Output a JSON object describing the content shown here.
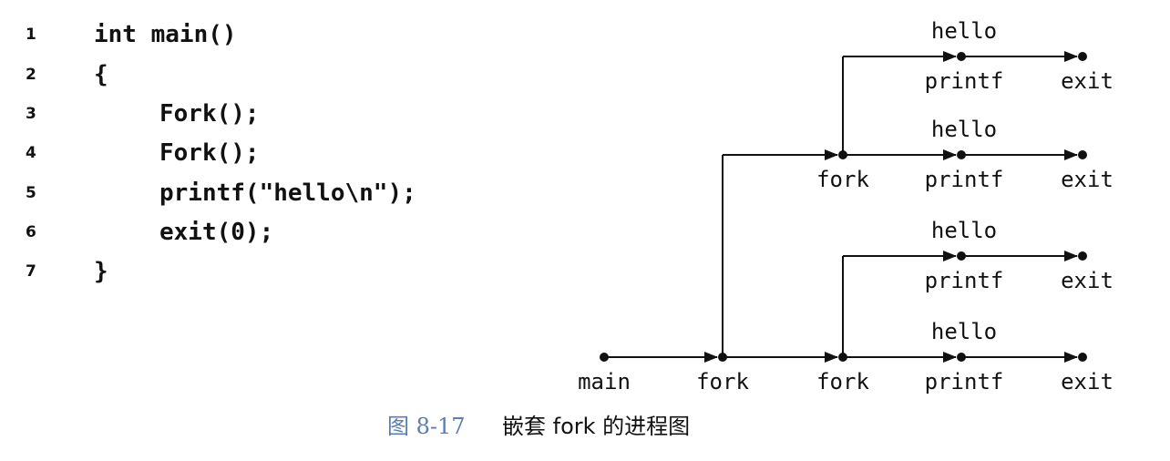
{
  "code": {
    "lines": [
      {
        "no": "1",
        "text": "int main()",
        "indent": 0
      },
      {
        "no": "2",
        "text": "{",
        "indent": 0
      },
      {
        "no": "3",
        "text": "Fork();",
        "indent": 1
      },
      {
        "no": "4",
        "text": "Fork();",
        "indent": 1
      },
      {
        "no": "5",
        "text": "printf(\"hello\\n\");",
        "indent": 1
      },
      {
        "no": "6",
        "text": "exit(0);",
        "indent": 1
      },
      {
        "no": "7",
        "text": "}",
        "indent": 0
      }
    ]
  },
  "diagram": {
    "labels": {
      "main": "main",
      "fork": "fork",
      "printf": "printf",
      "exit": "exit",
      "hello": "hello"
    }
  },
  "caption": {
    "label": "图 8-17",
    "text": "嵌套 fork 的进程图"
  }
}
